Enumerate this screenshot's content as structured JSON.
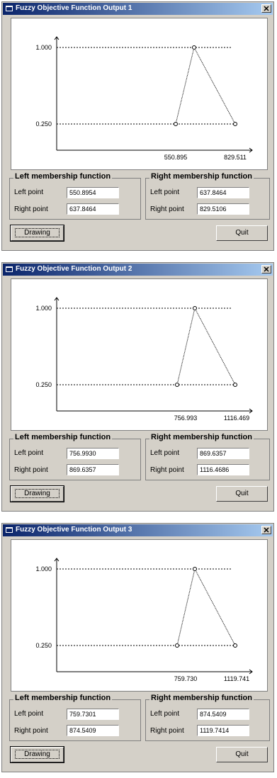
{
  "windows": [
    {
      "title": "Fuzzy Objective Function Output 1",
      "plot": {
        "y_high": "1.000",
        "y_low": "0.250",
        "x_left": "550.895",
        "x_right": "829.511"
      },
      "left_group": {
        "title": "Left membership function",
        "left_label": "Left point",
        "left_value": "550.8954",
        "right_label": "Right point",
        "right_value": "637.8464"
      },
      "right_group": {
        "title": "Right membership function",
        "left_label": "Left point",
        "left_value": "637.8464",
        "right_label": "Right point",
        "right_value": "829.5106"
      },
      "buttons": {
        "drawing": "Drawing",
        "quit": "Quit"
      }
    },
    {
      "title": "Fuzzy Objective Function Output 2",
      "plot": {
        "y_high": "1.000",
        "y_low": "0.250",
        "x_left": "756.993",
        "x_right": "1116.469"
      },
      "left_group": {
        "title": "Left membership function",
        "left_label": "Left point",
        "left_value": "756.9930",
        "right_label": "Right point",
        "right_value": "869.6357"
      },
      "right_group": {
        "title": "Right membership function",
        "left_label": "Left point",
        "left_value": "869.6357",
        "right_label": "Right point",
        "right_value": "1116.4686"
      },
      "buttons": {
        "drawing": "Drawing",
        "quit": "Quit"
      }
    },
    {
      "title": "Fuzzy Objective Function Output 3",
      "plot": {
        "y_high": "1.000",
        "y_low": "0.250",
        "x_left": "759.730",
        "x_right": "1119.741"
      },
      "left_group": {
        "title": "Left membership function",
        "left_label": "Left point",
        "left_value": "759.7301",
        "right_label": "Right point",
        "right_value": "874.5409"
      },
      "right_group": {
        "title": "Right membership function",
        "left_label": "Left point",
        "left_value": "874.5409",
        "right_label": "Right point",
        "right_value": "1119.7414"
      },
      "buttons": {
        "drawing": "Drawing",
        "quit": "Quit"
      }
    }
  ],
  "colors": {
    "titlebar_start": "#0a246a",
    "titlebar_end": "#a6caf0",
    "window_bg": "#d4d0c8",
    "plot_bg": "#ffffff"
  },
  "icons": {
    "window": "app-window-icon",
    "close": "close-icon"
  }
}
